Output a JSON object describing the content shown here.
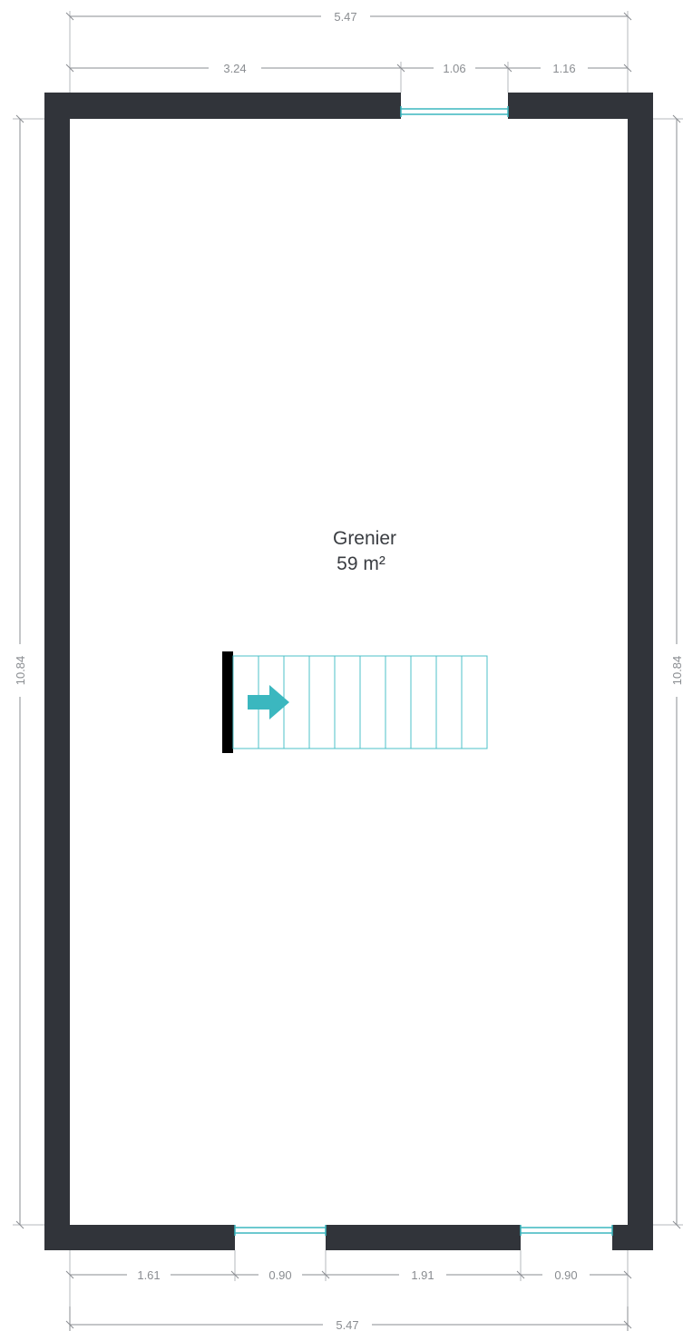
{
  "room": {
    "name": "Grenier",
    "area": "59 m²"
  },
  "dimensions": {
    "top_total": "5.47",
    "top_segments": [
      "3.24",
      "1.06",
      "1.16"
    ],
    "left_height": "10.84",
    "right_height": "10.84",
    "bottom_segments": [
      "1.61",
      "0.90",
      "1.91",
      "0.90"
    ],
    "bottom_total": "5.47"
  },
  "colors": {
    "wall": "#31343a",
    "window": "#3bb7bf",
    "stair": "#4cc1c8",
    "stair_arrow": "#3bb7bf",
    "dimension": "#8a8d91"
  },
  "icons": {
    "stair_direction": "right-arrow-icon"
  }
}
